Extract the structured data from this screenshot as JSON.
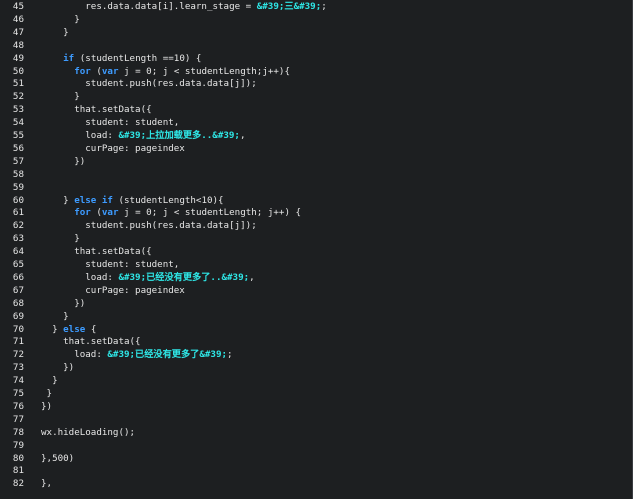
{
  "editor": {
    "colors": {
      "background": "#1d1f21",
      "text": "#e6e6e6",
      "keyword": "#3d9bff",
      "string": "#2ee6e6"
    },
    "lines": [
      {
        "num": "45",
        "segments": [
          {
            "t": "p",
            "v": "        res.data.data[i].learn_stage = "
          },
          {
            "t": "s",
            "v": "&#39;三&#39;"
          },
          {
            "t": "p",
            "v": ";"
          }
        ]
      },
      {
        "num": "46",
        "segments": [
          {
            "t": "p",
            "v": "      }"
          }
        ]
      },
      {
        "num": "47",
        "segments": [
          {
            "t": "p",
            "v": "    }"
          }
        ]
      },
      {
        "num": "48",
        "segments": []
      },
      {
        "num": "49",
        "segments": [
          {
            "t": "p",
            "v": "    "
          },
          {
            "t": "k",
            "v": "if"
          },
          {
            "t": "p",
            "v": " (studentLength ==10) {"
          }
        ]
      },
      {
        "num": "50",
        "segments": [
          {
            "t": "p",
            "v": "      "
          },
          {
            "t": "k",
            "v": "for"
          },
          {
            "t": "p",
            "v": " ("
          },
          {
            "t": "k",
            "v": "var"
          },
          {
            "t": "p",
            "v": " j = 0; j < studentLength;j++){"
          }
        ]
      },
      {
        "num": "51",
        "segments": [
          {
            "t": "p",
            "v": "        student.push(res.data.data[j]);"
          }
        ]
      },
      {
        "num": "52",
        "segments": [
          {
            "t": "p",
            "v": "      }"
          }
        ]
      },
      {
        "num": "53",
        "segments": [
          {
            "t": "p",
            "v": "      that.setData({"
          }
        ]
      },
      {
        "num": "54",
        "segments": [
          {
            "t": "p",
            "v": "        student: student,"
          }
        ]
      },
      {
        "num": "55",
        "segments": [
          {
            "t": "p",
            "v": "        load: "
          },
          {
            "t": "s",
            "v": "&#39;上拉加载更多..&#39;"
          },
          {
            "t": "p",
            "v": ","
          }
        ]
      },
      {
        "num": "56",
        "segments": [
          {
            "t": "p",
            "v": "        curPage: pageindex"
          }
        ]
      },
      {
        "num": "57",
        "segments": [
          {
            "t": "p",
            "v": "      })"
          }
        ]
      },
      {
        "num": "58",
        "segments": []
      },
      {
        "num": "59",
        "segments": []
      },
      {
        "num": "60",
        "segments": [
          {
            "t": "p",
            "v": "    } "
          },
          {
            "t": "k",
            "v": "else if"
          },
          {
            "t": "p",
            "v": " (studentLength<10){"
          }
        ]
      },
      {
        "num": "61",
        "segments": [
          {
            "t": "p",
            "v": "      "
          },
          {
            "t": "k",
            "v": "for"
          },
          {
            "t": "p",
            "v": " ("
          },
          {
            "t": "k",
            "v": "var"
          },
          {
            "t": "p",
            "v": " j = 0; j < studentLength; j++) {"
          }
        ]
      },
      {
        "num": "62",
        "segments": [
          {
            "t": "p",
            "v": "        student.push(res.data.data[j]);"
          }
        ]
      },
      {
        "num": "63",
        "segments": [
          {
            "t": "p",
            "v": "      }"
          }
        ]
      },
      {
        "num": "64",
        "segments": [
          {
            "t": "p",
            "v": "      that.setData({"
          }
        ]
      },
      {
        "num": "65",
        "segments": [
          {
            "t": "p",
            "v": "        student: student,"
          }
        ]
      },
      {
        "num": "66",
        "segments": [
          {
            "t": "p",
            "v": "        load: "
          },
          {
            "t": "s",
            "v": "&#39;已经没有更多了..&#39;"
          },
          {
            "t": "p",
            "v": ","
          }
        ]
      },
      {
        "num": "67",
        "segments": [
          {
            "t": "p",
            "v": "        curPage: pageindex"
          }
        ]
      },
      {
        "num": "68",
        "segments": [
          {
            "t": "p",
            "v": "      })"
          }
        ]
      },
      {
        "num": "69",
        "segments": [
          {
            "t": "p",
            "v": "    }"
          }
        ]
      },
      {
        "num": "70",
        "segments": [
          {
            "t": "p",
            "v": "  } "
          },
          {
            "t": "k",
            "v": "else"
          },
          {
            "t": "p",
            "v": " {"
          }
        ]
      },
      {
        "num": "71",
        "segments": [
          {
            "t": "p",
            "v": "    that.setData({"
          }
        ]
      },
      {
        "num": "72",
        "segments": [
          {
            "t": "p",
            "v": "      load: "
          },
          {
            "t": "s",
            "v": "&#39;已经没有更多了&#39;"
          },
          {
            "t": "p",
            "v": ";"
          }
        ]
      },
      {
        "num": "73",
        "segments": [
          {
            "t": "p",
            "v": "    })"
          }
        ]
      },
      {
        "num": "74",
        "segments": [
          {
            "t": "p",
            "v": "  }"
          }
        ]
      },
      {
        "num": "75",
        "segments": [
          {
            "t": "p",
            "v": " }"
          }
        ]
      },
      {
        "num": "76",
        "segments": [
          {
            "t": "p",
            "v": "})"
          }
        ]
      },
      {
        "num": "77",
        "segments": []
      },
      {
        "num": "78",
        "segments": [
          {
            "t": "p",
            "v": "wx.hideLoading();"
          }
        ]
      },
      {
        "num": "79",
        "segments": []
      },
      {
        "num": "80",
        "segments": [
          {
            "t": "p",
            "v": "},500)"
          }
        ]
      },
      {
        "num": "81",
        "segments": []
      },
      {
        "num": "82",
        "segments": [
          {
            "t": "p",
            "v": "},"
          }
        ]
      }
    ]
  }
}
